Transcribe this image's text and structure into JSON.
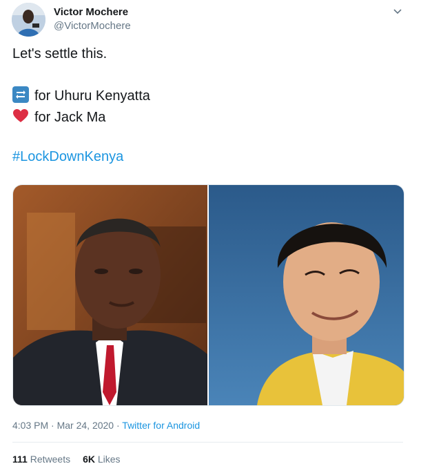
{
  "author": {
    "name": "Victor Mochere",
    "handle": "@VictorMochere"
  },
  "tweet": {
    "line1": "Let's settle this.",
    "option_retweet": "for Uhuru Kenyatta",
    "option_like": "for Jack Ma",
    "hashtag": "#LockDownKenya"
  },
  "media": {
    "left_alt": "Uhuru Kenyatta photo",
    "right_alt": "Jack Ma photo"
  },
  "meta": {
    "time": "4:03 PM",
    "sep1": " · ",
    "date": "Mar 24, 2020",
    "sep2": " · ",
    "source": "Twitter for Android"
  },
  "stats": {
    "retweets_count": "111",
    "retweets_label": "Retweets",
    "likes_count": "6K",
    "likes_label": "Likes"
  },
  "colors": {
    "link": "#1b95e0",
    "secondary": "#657786",
    "heart": "#dd2e44",
    "retweet_emoji": "#3b88c3"
  },
  "icons": [
    "caret-down-icon",
    "retweet-emoji-icon",
    "heart-emoji-icon"
  ]
}
